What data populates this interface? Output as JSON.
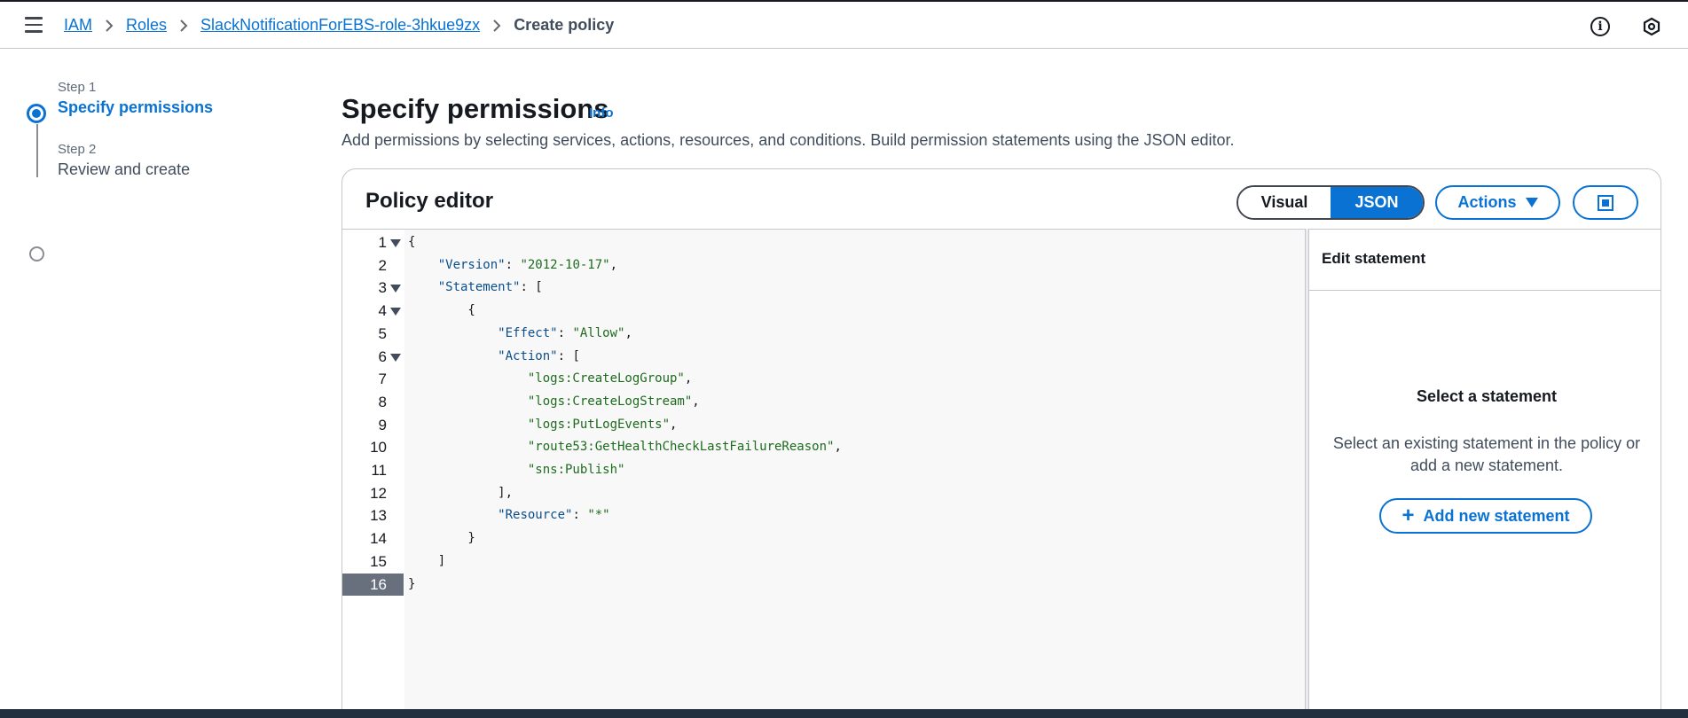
{
  "breadcrumb": {
    "items": [
      "IAM",
      "Roles",
      "SlackNotificationForEBS-role-3hkue9zx"
    ],
    "current": "Create policy"
  },
  "wizard": {
    "step1_label": "Step 1",
    "step1_title": "Specify permissions",
    "step2_label": "Step 2",
    "step2_title": "Review and create"
  },
  "header": {
    "title": "Specify permissions",
    "info": "Info",
    "description": "Add permissions by selecting services, actions, resources, and conditions. Build permission statements using the JSON editor."
  },
  "editor": {
    "title": "Policy editor",
    "mode_visual": "Visual",
    "mode_json": "JSON",
    "selected_mode": "JSON",
    "actions_label": "Actions",
    "active_line": 16,
    "lines": [
      {
        "n": "1",
        "text": "{"
      },
      {
        "n": "2",
        "text": "    \"Version\": \"2012-10-17\","
      },
      {
        "n": "3",
        "text": "    \"Statement\": ["
      },
      {
        "n": "4",
        "text": "        {"
      },
      {
        "n": "5",
        "text": "            \"Effect\": \"Allow\","
      },
      {
        "n": "6",
        "text": "            \"Action\": ["
      },
      {
        "n": "7",
        "text": "                \"logs:CreateLogGroup\","
      },
      {
        "n": "8",
        "text": "                \"logs:CreateLogStream\","
      },
      {
        "n": "9",
        "text": "                \"logs:PutLogEvents\","
      },
      {
        "n": "10",
        "text": "                \"route53:GetHealthCheckLastFailureReason\","
      },
      {
        "n": "11",
        "text": "                \"sns:Publish\""
      },
      {
        "n": "12",
        "text": "            ],"
      },
      {
        "n": "13",
        "text": "            \"Resource\": \"*\""
      },
      {
        "n": "14",
        "text": "        }"
      },
      {
        "n": "15",
        "text": "    ]"
      },
      {
        "n": "16",
        "text": "}"
      }
    ]
  },
  "side_panel": {
    "header": "Edit statement",
    "empty_title": "Select a statement",
    "empty_desc": "Select an existing statement in the policy or add a new statement.",
    "add_button": "Add new statement"
  },
  "colors": {
    "accent": "#0972d3",
    "text": "#16191f",
    "json_key": "#0b4e8c",
    "json_string": "#1d6b1d"
  }
}
